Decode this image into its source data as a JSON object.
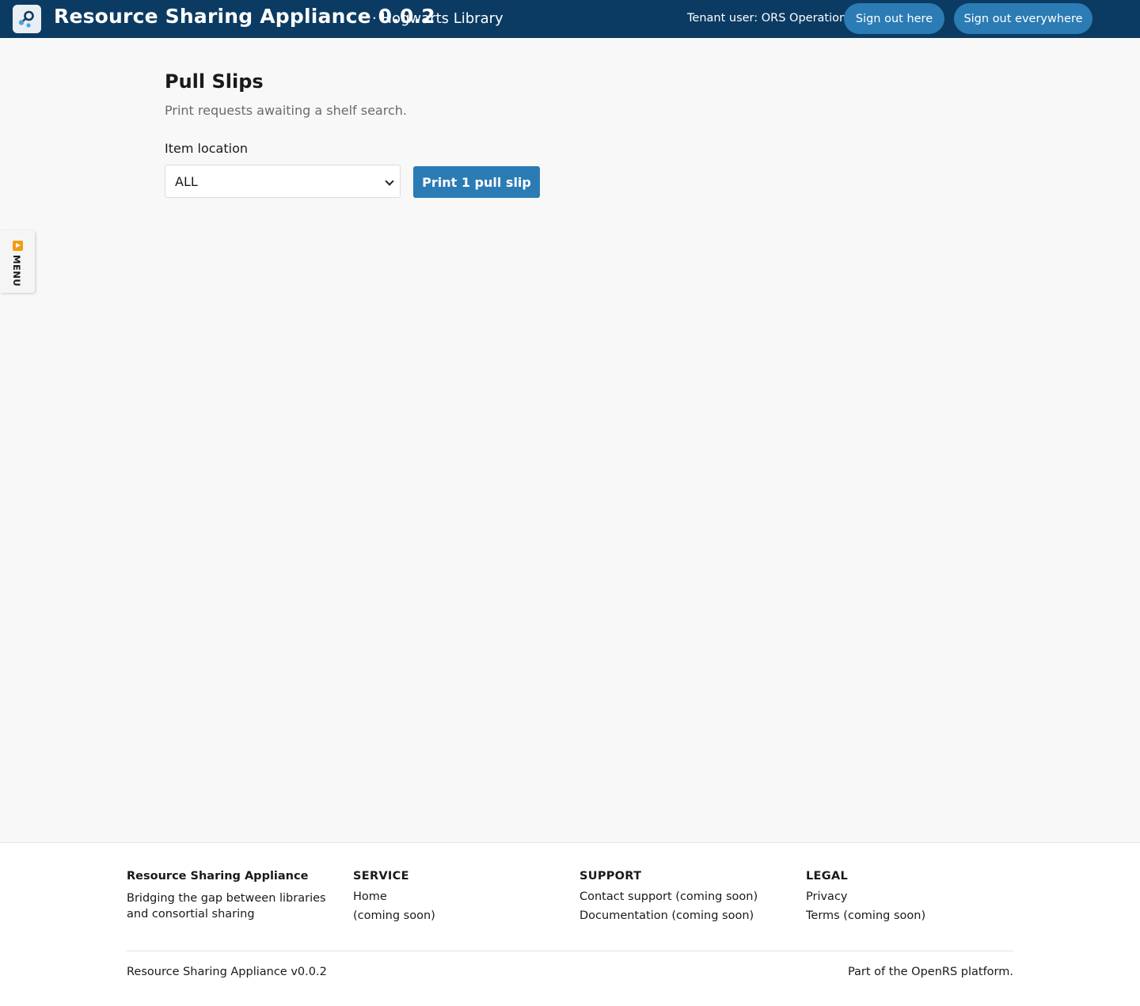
{
  "header": {
    "app_title": "Resource Sharing Appliance 0.0.2",
    "tenant_name": "· Hogwarts Library",
    "tenant_user": "Tenant user: ORS Operations",
    "sign_out_here": "Sign out here",
    "sign_out_everywhere": "Sign out everywhere",
    "logo_icon": "share-node-icon",
    "bg_color": "#0b3b63",
    "accent_color": "#2b7bb5"
  },
  "side_menu": {
    "label": "MENU",
    "icon": "play-arrow-icon",
    "icon_color": "#f39c12"
  },
  "main": {
    "title": "Pull Slips",
    "subtitle": "Print requests awaiting a shelf search.",
    "location_label": "Item location",
    "location_value": "ALL",
    "print_button": "Print 1 pull slip"
  },
  "footer": {
    "brand": {
      "title": "Resource Sharing Appliance",
      "description": "Bridging the gap between libraries and consortial sharing"
    },
    "service": {
      "heading": "SERVICE",
      "links": [
        "Home",
        "(coming soon)"
      ]
    },
    "support": {
      "heading": "SUPPORT",
      "links": [
        "Contact support (coming soon)",
        "Documentation (coming soon)"
      ]
    },
    "legal": {
      "heading": "LEGAL",
      "links": [
        "Privacy",
        "Terms (coming soon)"
      ]
    },
    "version": "Resource Sharing Appliance v0.0.2",
    "platform": "Part of the OpenRS platform."
  }
}
